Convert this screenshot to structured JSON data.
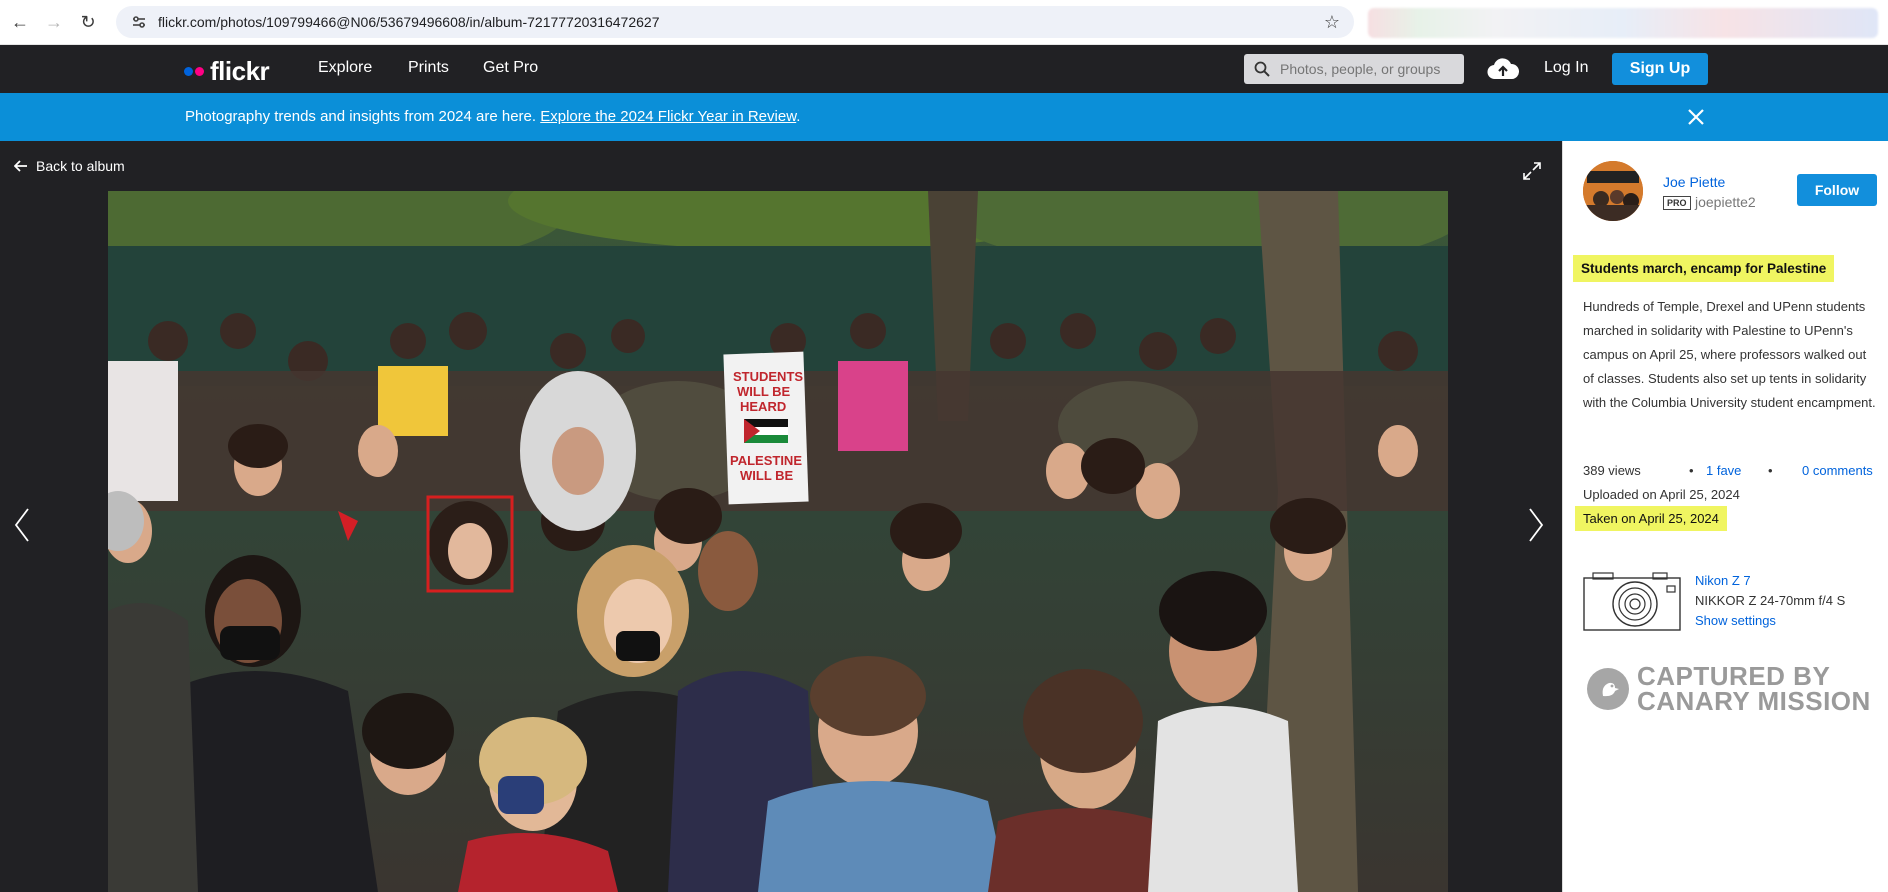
{
  "browser": {
    "url": "flickr.com/photos/109799466@N06/53679496608/in/album-72177720316472627"
  },
  "header": {
    "logo_text": "flickr",
    "logo_colors": [
      "#0063dc",
      "#ff0084"
    ],
    "nav": [
      "Explore",
      "Prints",
      "Get Pro"
    ],
    "search_placeholder": "Photos, people, or groups",
    "login_label": "Log In",
    "signup_label": "Sign Up"
  },
  "banner": {
    "text": "Photography trends and insights from 2024 are here. ",
    "link": "Explore the 2024 Flickr Year in Review",
    "suffix": "."
  },
  "viewer": {
    "back_label": "Back to album",
    "sign_text": [
      "STUDENTS",
      "WILL BE",
      "HEARD",
      "PALESTINE",
      "WILL BE"
    ]
  },
  "sidebar": {
    "author_name": "Joe Piette",
    "pro_label": "PRO",
    "username": "joepiette2",
    "follow_label": "Follow",
    "title": "Students march, encamp for Palestine",
    "description": "Hundreds of Temple, Drexel and UPenn students marched in solidarity with Palestine to UPenn's campus on April 25, where professors walked out of classes. Students also set up tents in solidarity with the Columbia University student encampment.",
    "views": "389 views",
    "faves": "1 fave",
    "comments": "0 comments",
    "uploaded": "Uploaded on April 25, 2024",
    "taken": "Taken on April 25, 2024",
    "camera_model": "Nikon Z 7",
    "camera_lens": "NIKKOR Z 24-70mm f/4 S",
    "show_settings": "Show settings",
    "watermark_line1": "CAPTURED BY",
    "watermark_line2": "CANARY MISSION",
    "highlight_color": "#f0f561",
    "accent_color": "#128fdc"
  }
}
